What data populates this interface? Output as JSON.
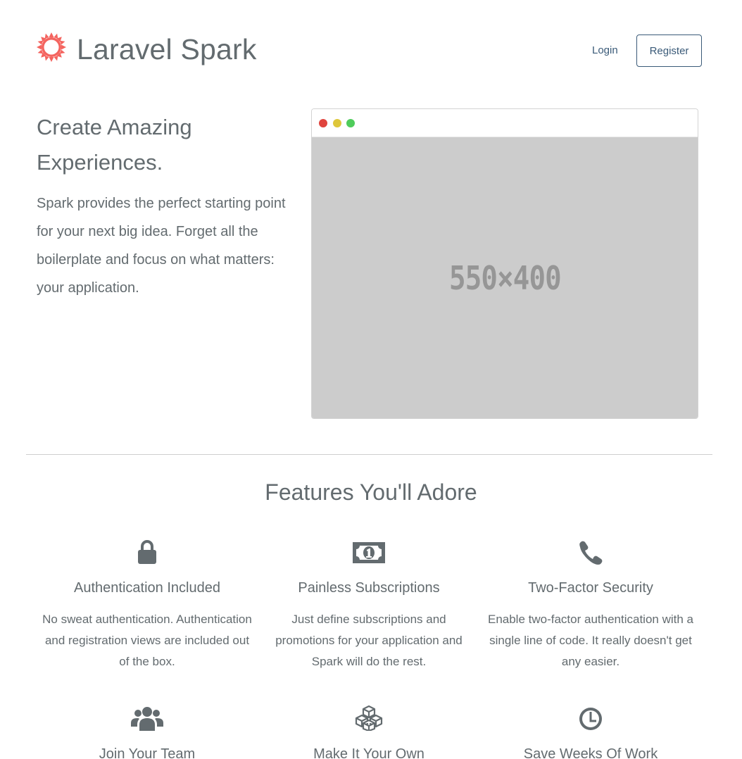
{
  "brand": {
    "name": "Laravel Spark",
    "logo_icon": "spark-sun-icon",
    "logo_color": "#f4645f"
  },
  "nav": {
    "login_label": "Login",
    "register_label": "Register",
    "link_color": "#3a5a78"
  },
  "hero": {
    "title": "Create Amazing Experiences.",
    "text": "Spark provides the perfect starting point for your next big idea. Forget all the boilerplate and focus on what matters: your application.",
    "screenshot_placeholder": "550×400"
  },
  "features": {
    "title": "Features You'll Adore",
    "items": [
      {
        "name": "Authentication Included",
        "icon": "lock-icon",
        "desc": "No sweat authentication. Authentication and registration views are included out of the box."
      },
      {
        "name": "Painless Subscriptions",
        "icon": "money-icon",
        "desc": "Just define subscriptions and promotions for your application and Spark will do the rest."
      },
      {
        "name": "Two-Factor Security",
        "icon": "phone-icon",
        "desc": "Enable two-factor authentication with a single line of code. It really doesn't get any easier."
      },
      {
        "name": "Join Your Team",
        "icon": "users-icon",
        "desc": ""
      },
      {
        "name": "Make It Your Own",
        "icon": "cubes-icon",
        "desc": ""
      },
      {
        "name": "Save Weeks Of Work",
        "icon": "clock-icon",
        "desc": ""
      }
    ]
  }
}
